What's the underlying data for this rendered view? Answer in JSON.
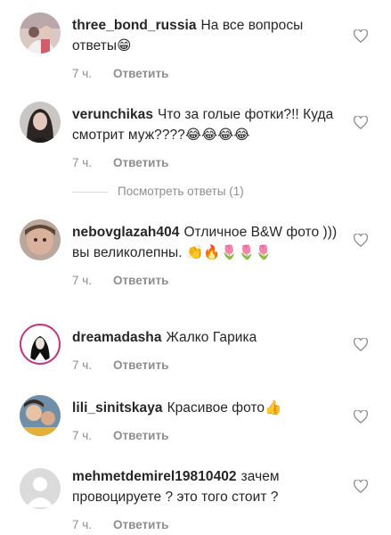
{
  "comments": [
    {
      "username": "three_bond_russia",
      "text": "На все вопросы ответы😁",
      "time": "7 ч.",
      "reply_label": "Ответить"
    },
    {
      "username": "verunchikas",
      "text": "Что за голые фотки?!! Куда смотрит муж????😂😂😂😂",
      "time": "7 ч.",
      "reply_label": "Ответить"
    },
    {
      "username": "nebovglazah404",
      "text": "Отличное B&W фото ))) вы великолепны. 👏🔥🌷🌷🌷",
      "time": "7 ч.",
      "reply_label": "Ответить"
    },
    {
      "username": "dreamadasha",
      "text": "Жалко Гарика",
      "time": "7 ч.",
      "reply_label": "Ответить"
    },
    {
      "username": "lili_sinitskaya",
      "text": "Красивое фото👍",
      "time": "7 ч.",
      "reply_label": "Ответить"
    },
    {
      "username": "mehmetdemirel19810402",
      "text": "зачем провоцируете ? это того стоит ?",
      "time": "7 ч.",
      "reply_label": "Ответить"
    }
  ],
  "view_replies_label": "Посмотреть ответы (1)",
  "colors": {
    "text": "#262626",
    "muted": "#8e8e8e",
    "divider": "#dbdbdb",
    "story_ring": "#c13584"
  }
}
